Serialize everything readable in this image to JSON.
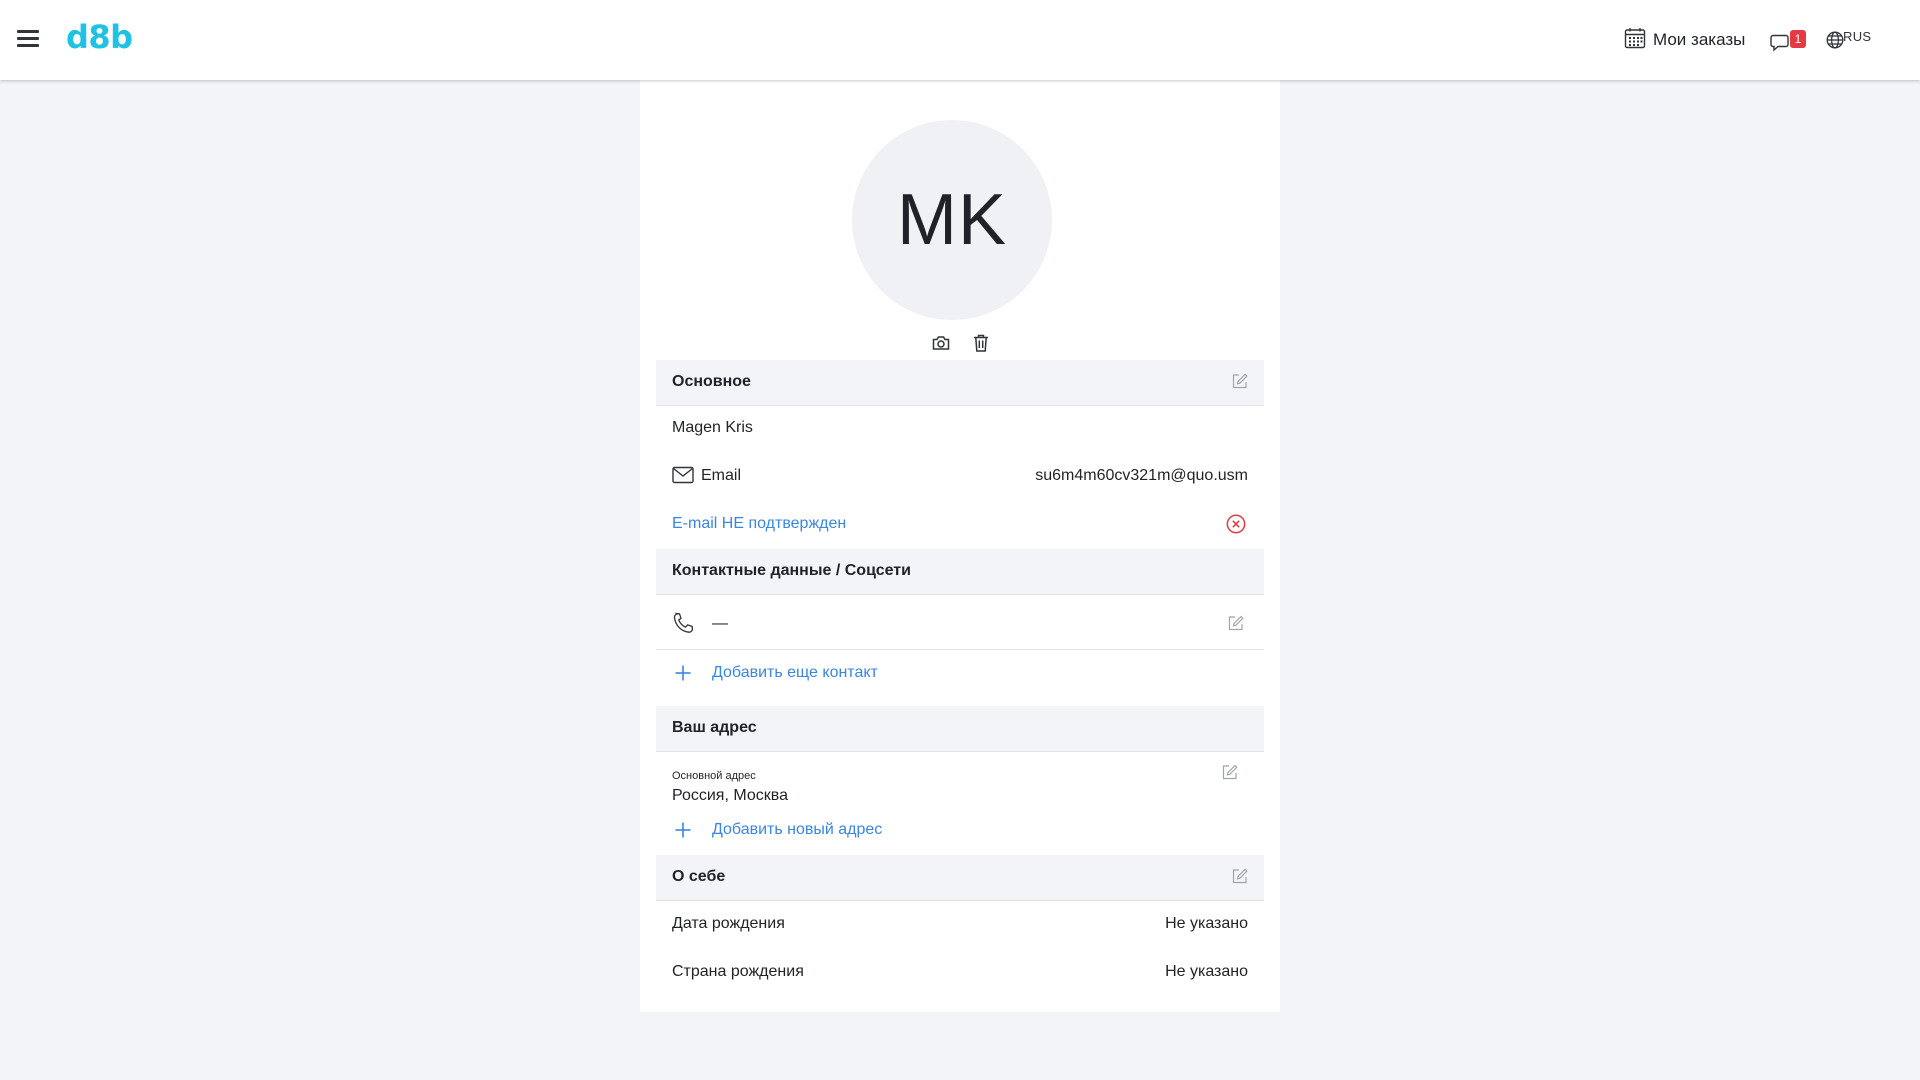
{
  "header": {
    "logo": "d8b",
    "orders_label": "Мои заказы",
    "chat_badge": "1",
    "language": "RUS"
  },
  "profile": {
    "initials": "MK"
  },
  "basic": {
    "title": "Основное",
    "name": "Magen Kris",
    "email_label": "Email",
    "email_value": "su6m4m60cv321m@quo.usm",
    "email_status": "E-mail НЕ подтвержден"
  },
  "contacts": {
    "title": "Контактные данные / Соцсети",
    "phone_value": "—",
    "add_contact": "Добавить еще контакт"
  },
  "address": {
    "title": "Ваш адрес",
    "main_label": "Основной адрес",
    "main_value": "Россия, Москва",
    "add_address": "Добавить новый адрес"
  },
  "about": {
    "title": "О себе",
    "birth_date_label": "Дата рождения",
    "birth_date_value": "Не указано",
    "birth_country_label": "Страна рождения",
    "birth_country_value": "Не указано"
  },
  "colors": {
    "brand": "#1fc1e4",
    "link": "#3a86e0",
    "error": "#e53a43",
    "section_bg": "#f3f4f8"
  }
}
